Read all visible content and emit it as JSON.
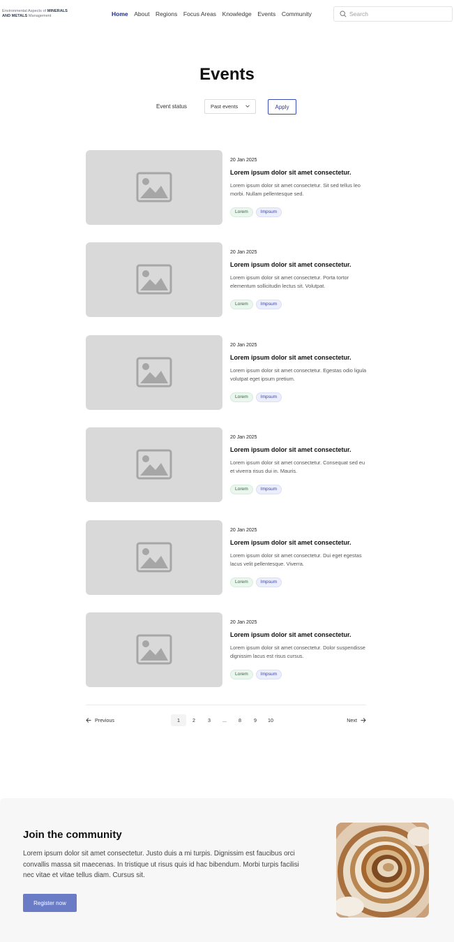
{
  "header": {
    "logo_prefix": "Environmental Aspects of ",
    "logo_bold1": "MINERALS",
    "logo_bold2": "AND METALS",
    "logo_suffix": " Management",
    "nav": [
      "Home",
      "About",
      "Regions",
      "Focus Areas",
      "Knowledge",
      "Events",
      "Community"
    ],
    "search_placeholder": "Search"
  },
  "page": {
    "title": "Events",
    "filter_label": "Event status",
    "filter_value": "Past events",
    "apply_label": "Apply"
  },
  "events": [
    {
      "date": "20 Jan 2025",
      "title": "Lorem ipsum dolor sit amet consectetur.",
      "desc": "Lorem ipsum dolor sit amet consectetur. Sit sed tellus leo morbi. Nullam pellentesque sed.",
      "tags": [
        "Lorem",
        "Impsum"
      ]
    },
    {
      "date": "20 Jan 2025",
      "title": "Lorem ipsum dolor sit amet consectetur.",
      "desc": "Lorem ipsum dolor sit amet consectetur. Porta tortor elementum sollicitudin lectus sit. Volutpat.",
      "tags": [
        "Lorem",
        "Impsum"
      ]
    },
    {
      "date": "20 Jan 2025",
      "title": "Lorem ipsum dolor sit amet consectetur.",
      "desc": "Lorem ipsum dolor sit amet consectetur. Egestas odio ligula volutpat eget ipsum pretium.",
      "tags": [
        "Lorem",
        "Impsum"
      ]
    },
    {
      "date": "20 Jan 2025",
      "title": "Lorem ipsum dolor sit amet consectetur.",
      "desc": "Lorem ipsum dolor sit amet consectetur. Consequat sed eu et viverra risus dui in. Mauris.",
      "tags": [
        "Lorem",
        "Impsum"
      ]
    },
    {
      "date": "20 Jan 2025",
      "title": "Lorem ipsum dolor sit amet consectetur.",
      "desc": "Lorem ipsum dolor sit amet consectetur. Dui eget egestas lacus velit pellentesque. Viverra.",
      "tags": [
        "Lorem",
        "Impsum"
      ]
    },
    {
      "date": "20 Jan 2025",
      "title": "Lorem ipsum dolor sit amet consectetur.",
      "desc": "Lorem ipsum dolor sit amet consectetur. Dolor suspendisse dignissim lacus est risus cursus.",
      "tags": [
        "Lorem",
        "Impsum"
      ]
    }
  ],
  "pagination": {
    "previous": "Previous",
    "next": "Next",
    "pages": [
      "1",
      "2",
      "3",
      "...",
      "8",
      "9",
      "10"
    ],
    "current": "1"
  },
  "community": {
    "title": "Join the community",
    "text": "Lorem ipsum dolor sit amet consectetur. Justo duis a mi turpis. Dignissim est faucibus orci convallis massa sit maecenas. In tristique ut risus quis id hac bibendum. Morbi turpis facilisi nec vitae et vitae tellus diam. Cursus sit.",
    "button": "Register now"
  },
  "colors": {
    "nav_active": "#1f2e8a",
    "apply_border": "#3a4bb5",
    "register_bg": "#6b7cc6",
    "placeholder_bg": "#d9d9d9",
    "community_bg": "#f7f7f8"
  }
}
